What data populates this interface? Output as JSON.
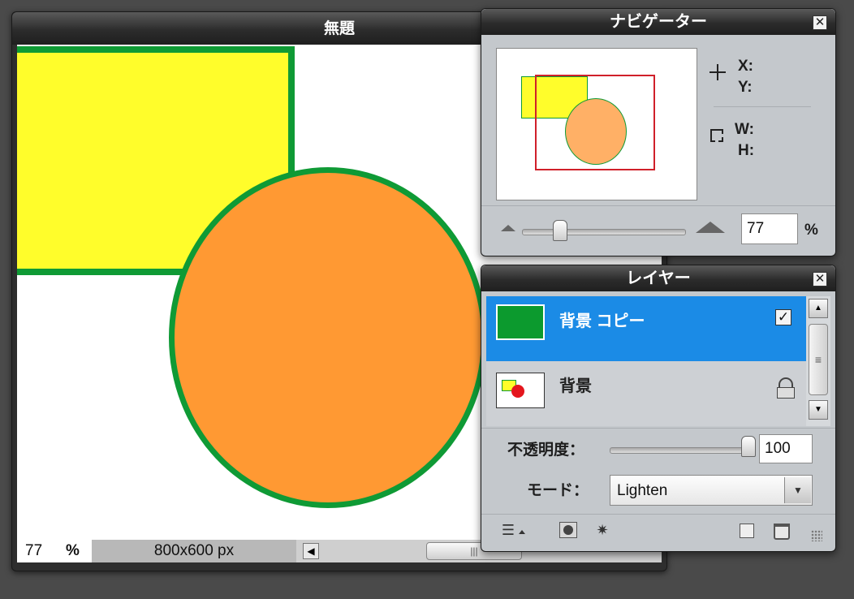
{
  "document": {
    "title": "無題",
    "zoom_value": "77",
    "zoom_unit": "%",
    "canvas_size": "800x600 px",
    "scroll_grip": "|||"
  },
  "navigator": {
    "title": "ナビゲーター",
    "close_glyph": "✕",
    "x_label": "X:",
    "y_label": "Y:",
    "w_label": "W:",
    "h_label": "H:",
    "zoom_value": "77",
    "zoom_unit": "%"
  },
  "layers": {
    "title": "レイヤー",
    "close_glyph": "✕",
    "items": [
      {
        "name": "背景 コピー",
        "selected": true,
        "visible_checked": true,
        "thumb_color": "#0c9a2e"
      },
      {
        "name": "背景",
        "selected": false,
        "locked": true
      }
    ],
    "opacity_label": "不透明度：",
    "opacity_value": "100",
    "mode_label": "モード：",
    "mode_value": "Lighten",
    "scroll_grip": "≡"
  },
  "colors": {
    "selection_blue": "#1b8be6",
    "yellow": "#fffd2b",
    "orange": "#ff9933",
    "green": "#0f9a35",
    "nav_frame_red": "#d0202a"
  },
  "icons": [
    "close-icon",
    "crosshair-icon",
    "crop-icon",
    "zoom-out-icon",
    "zoom-in-icon",
    "scroll-up-icon",
    "scroll-down-icon",
    "checkbox-icon",
    "lock-icon",
    "dropdown-arrow-icon",
    "layer-styles-icon",
    "mask-icon",
    "adjustment-icon",
    "new-layer-icon",
    "trash-icon",
    "resize-grip-icon"
  ]
}
